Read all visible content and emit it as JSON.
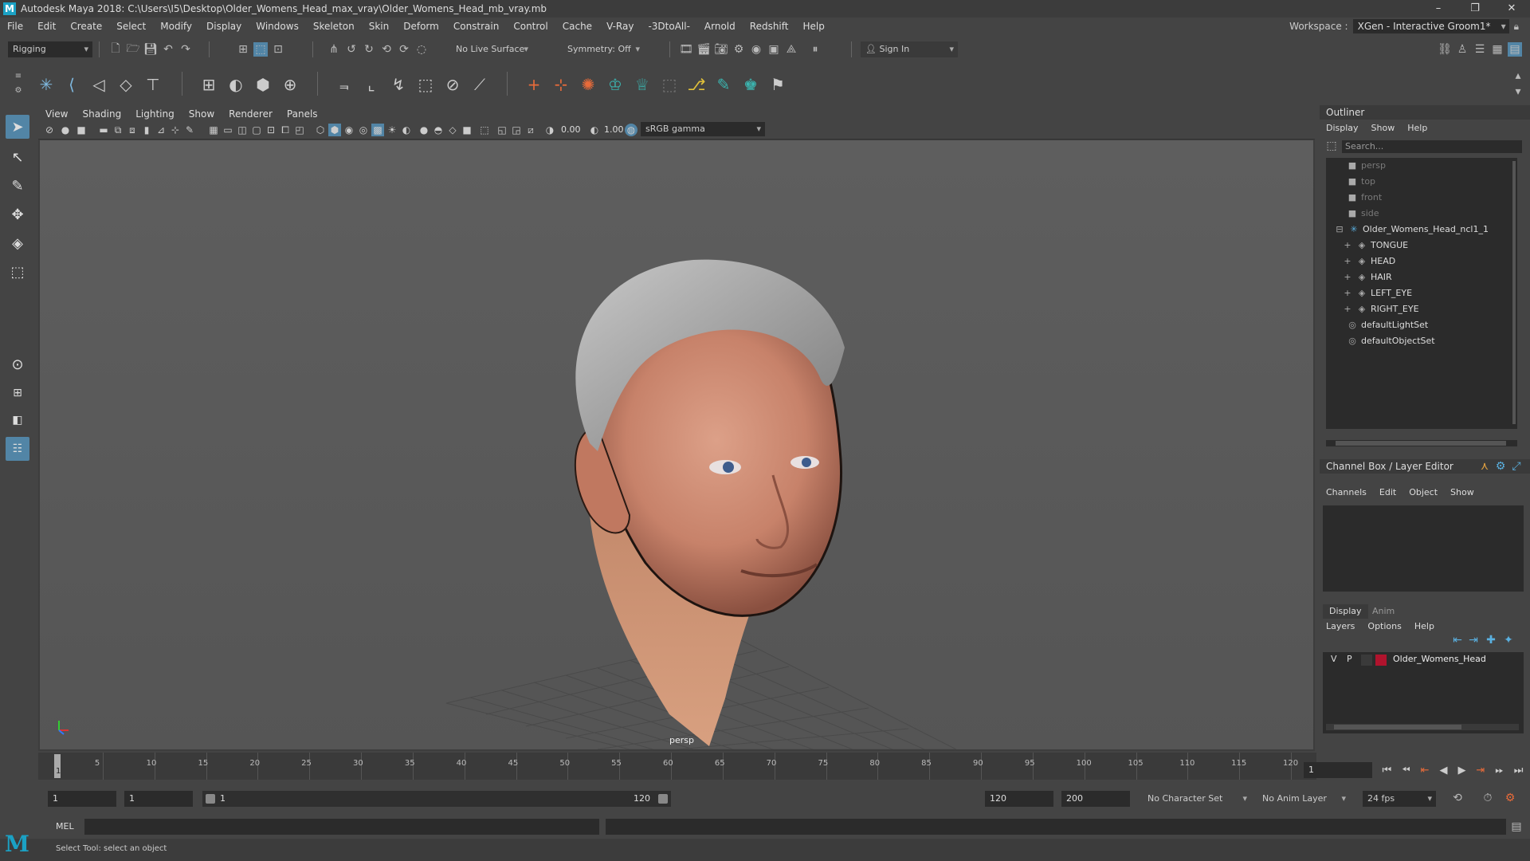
{
  "titlebar": {
    "title": "Autodesk Maya 2018: C:\\Users\\I5\\Desktop\\Older_Womens_Head_max_vray\\Older_Womens_Head_mb_vray.mb",
    "minimize": "–",
    "restore": "❐",
    "close": "✕"
  },
  "menus": [
    "File",
    "Edit",
    "Create",
    "Select",
    "Modify",
    "Display",
    "Windows",
    "Skeleton",
    "Skin",
    "Deform",
    "Constrain",
    "Control",
    "Cache",
    "V-Ray",
    "-3DtoAll-",
    "Arnold",
    "Redshift",
    "Help"
  ],
  "workspace": {
    "label": "Workspace :",
    "value": "XGen - Interactive Groom1*"
  },
  "statusline": {
    "mode": "Rigging",
    "live_surface": "No Live Surface",
    "symmetry": "Symmetry: Off",
    "sign_in": "Sign In"
  },
  "viewport": {
    "menus": [
      "View",
      "Shading",
      "Lighting",
      "Show",
      "Renderer",
      "Panels"
    ],
    "exposure": "0.00",
    "gamma": "1.00",
    "color_space": "sRGB gamma",
    "camera_label": "persp"
  },
  "outliner": {
    "title": "Outliner",
    "menus": [
      "Display",
      "Show",
      "Help"
    ],
    "search_placeholder": "Search...",
    "items": [
      {
        "label": "persp",
        "kind": "camera"
      },
      {
        "label": "top",
        "kind": "camera"
      },
      {
        "label": "front",
        "kind": "camera"
      },
      {
        "label": "side",
        "kind": "camera"
      },
      {
        "label": "Older_Womens_Head_ncl1_1",
        "kind": "group"
      },
      {
        "label": "TONGUE",
        "kind": "mesh"
      },
      {
        "label": "HEAD",
        "kind": "mesh"
      },
      {
        "label": "HAIR",
        "kind": "mesh"
      },
      {
        "label": "LEFT_EYE",
        "kind": "mesh"
      },
      {
        "label": "RIGHT_EYE",
        "kind": "mesh"
      },
      {
        "label": "defaultLightSet",
        "kind": "set"
      },
      {
        "label": "defaultObjectSet",
        "kind": "set"
      }
    ]
  },
  "channelbox": {
    "title": "Channel Box / Layer Editor",
    "menus": [
      "Channels",
      "Edit",
      "Object",
      "Show"
    ]
  },
  "layers": {
    "tabs": [
      "Display",
      "Anim"
    ],
    "menus": [
      "Layers",
      "Options",
      "Help"
    ],
    "row": {
      "v": "V",
      "p": "P",
      "name": "Older_Womens_Head",
      "color": "#b0132d"
    }
  },
  "timeslider": {
    "ticks": [
      "5",
      "10",
      "15",
      "20",
      "25",
      "30",
      "35",
      "40",
      "45",
      "50",
      "55",
      "60",
      "65",
      "70",
      "75",
      "80",
      "85",
      "90",
      "95",
      "100",
      "105",
      "110",
      "115",
      "120"
    ],
    "current_frame_left": "1",
    "current_frame_field": "1"
  },
  "range": {
    "start": "1",
    "playback_start": "1",
    "slider_start": "1",
    "slider_end": "120",
    "playback_end": "120",
    "end": "200",
    "character_set": "No Character Set",
    "anim_layer": "No Anim Layer",
    "fps": "24 fps"
  },
  "commandline": {
    "label": "MEL"
  },
  "helpline": {
    "text": "Select Tool: select an object"
  },
  "colors": {
    "accent": "#5285a6",
    "maya_blue": "#1ba1c4"
  }
}
